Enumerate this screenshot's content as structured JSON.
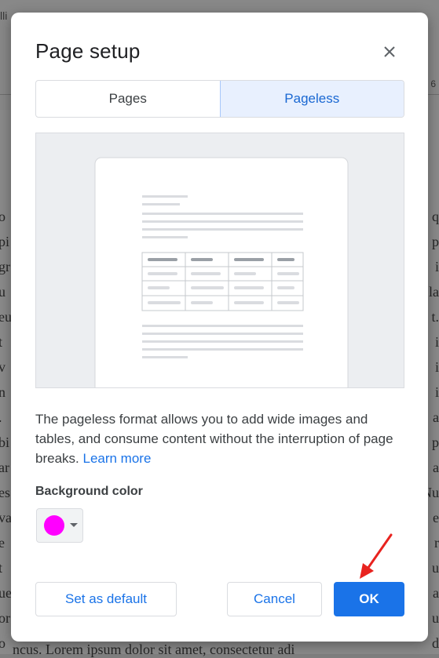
{
  "background": {
    "top_label": "lli",
    "ruler_number": "6",
    "left_fragments": [
      "o",
      "pi",
      "gr",
      "u",
      "eu",
      "t",
      "v",
      "n",
      ".",
      "bi",
      "ar",
      "es",
      "va",
      "e",
      "t",
      "ue",
      "or",
      "o"
    ],
    "right_fragments": [
      "q",
      "p",
      "i",
      "la",
      "t.",
      "i",
      "i",
      "i",
      "a",
      "p",
      "a",
      "Nu",
      "e",
      "r",
      "u",
      "a",
      "u",
      "d"
    ],
    "bottom_line": "ncus. Lorem ipsum dolor sit amet, consectetur adi"
  },
  "dialog": {
    "title": "Page setup",
    "close_icon": "close-icon",
    "tabs": [
      {
        "label": "Pages",
        "selected": false
      },
      {
        "label": "Pageless",
        "selected": true
      }
    ],
    "description": "The pageless format allows you to add wide images and tables, and consume content without the interruption of page breaks.",
    "learn_more": "Learn more",
    "background_color_label": "Background color",
    "background_color": "#ff00ff",
    "buttons": {
      "set_default": "Set as default",
      "cancel": "Cancel",
      "ok": "OK"
    }
  },
  "colors": {
    "accent": "#1a73e8",
    "selected_tab_bg": "#e8f0fe",
    "annotation_arrow": "#e8231f"
  }
}
